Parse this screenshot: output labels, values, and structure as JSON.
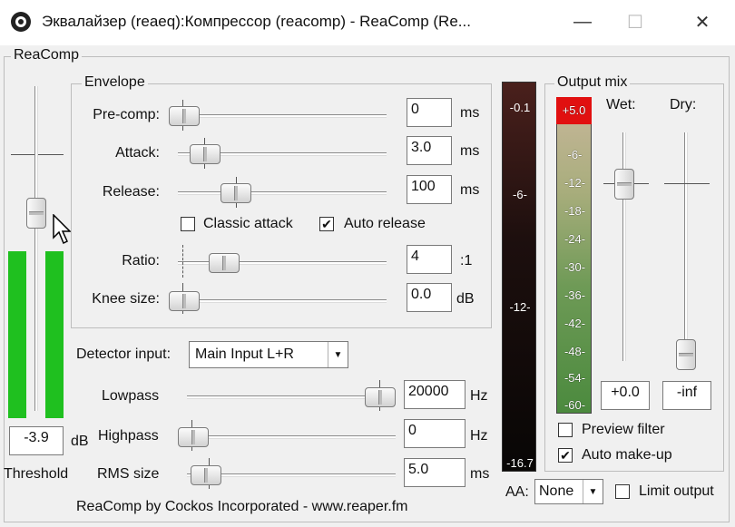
{
  "window": {
    "title": "Эквалайзер (reaeq):Компрессор (reacomp) - ReaComp (Re...",
    "minimize_glyph": "—",
    "maximize_glyph": "☐",
    "close_glyph": "✕"
  },
  "plugin": {
    "group_label": "ReaComp",
    "footer": "ReaComp by Cockos Incorporated - www.reaper.fm"
  },
  "threshold": {
    "value": "-3.9",
    "unit": "dB",
    "label": "Threshold"
  },
  "envelope": {
    "label": "Envelope",
    "precomp": {
      "label": "Pre-comp:",
      "value": "0",
      "unit": "ms"
    },
    "attack": {
      "label": "Attack:",
      "value": "3.0",
      "unit": "ms"
    },
    "release": {
      "label": "Release:",
      "value": "100",
      "unit": "ms"
    },
    "classic_attack": {
      "label": "Classic attack",
      "checked": false,
      "mark": ""
    },
    "auto_release": {
      "label": "Auto release",
      "checked": true,
      "mark": "✔"
    },
    "ratio": {
      "label": "Ratio:",
      "value": "4",
      "unit": ":1"
    },
    "knee": {
      "label": "Knee size:",
      "value": "0.0",
      "unit": "dB"
    }
  },
  "detector": {
    "label": "Detector input:",
    "selected": "Main Input L+R"
  },
  "lowpass": {
    "label": "Lowpass",
    "value": "20000",
    "unit": "Hz"
  },
  "highpass": {
    "label": "Highpass",
    "value": "0",
    "unit": "Hz"
  },
  "rms": {
    "label": "RMS size",
    "value": "5.0",
    "unit": "ms"
  },
  "gr_meter": {
    "labels": [
      "-0.1",
      "-6-",
      "-12-",
      "-16.7"
    ]
  },
  "output_mix": {
    "label": "Output mix",
    "wet": {
      "label": "Wet:",
      "value": "+0.0"
    },
    "dry": {
      "label": "Dry:",
      "value": "-inf"
    },
    "meter_top": "+5.0",
    "meter_labels": [
      "-6-",
      "-12-",
      "-18-",
      "-24-",
      "-30-",
      "-36-",
      "-42-",
      "-48-",
      "-54-",
      "-60-"
    ],
    "preview_filter": {
      "label": "Preview filter",
      "checked": false,
      "mark": ""
    },
    "auto_makeup": {
      "label": "Auto make-up",
      "checked": true,
      "mark": "✔"
    }
  },
  "aa": {
    "label": "AA:",
    "selected": "None"
  },
  "limit_output": {
    "label": "Limit output",
    "checked": false,
    "mark": ""
  },
  "colors": {
    "meter_green": "#1fc01f",
    "meter_clip": "#e11010"
  }
}
